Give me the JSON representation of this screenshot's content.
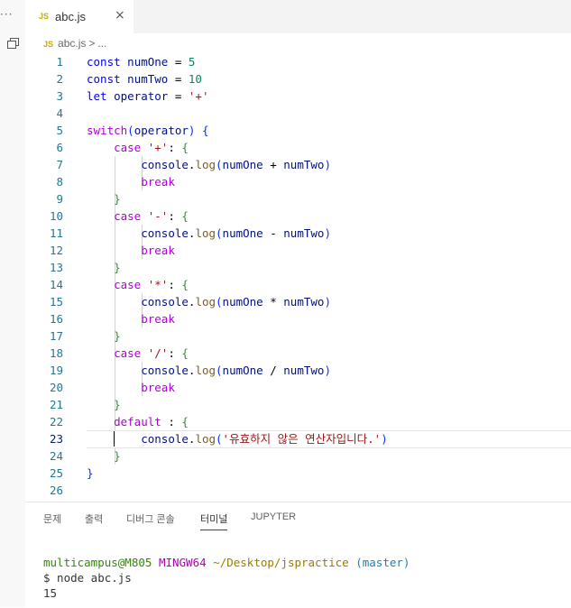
{
  "activity": {
    "more_label": "···",
    "copy_icon": "restore-icon"
  },
  "tab": {
    "badge": "JS",
    "filename": "abc.js",
    "close_glyph": "×"
  },
  "breadcrumb": {
    "badge": "JS",
    "file": "abc.js",
    "separator": ">",
    "ellipsis": "..."
  },
  "editor": {
    "line_numbers": [
      "1",
      "2",
      "3",
      "4",
      "5",
      "6",
      "7",
      "8",
      "9",
      "10",
      "11",
      "12",
      "13",
      "14",
      "15",
      "16",
      "17",
      "18",
      "19",
      "20",
      "21",
      "22",
      "23",
      "24",
      "25",
      "26"
    ],
    "current_line": 23
  },
  "panel": {
    "tabs": [
      "문제",
      "출력",
      "디버그 콘솔",
      "터미널",
      "JUPYTER"
    ],
    "active_tab": "터미널",
    "terminal": {
      "user": "multicampus@M805",
      "system": "MINGW64",
      "path": "~/Desktop/jspractice",
      "branch": "(master)",
      "command": "$ node abc.js",
      "output": "15"
    }
  },
  "colors": {
    "keyword": "#0000ff",
    "control": "#af00db",
    "string": "#a31515",
    "number": "#098658",
    "function": "#795e26"
  }
}
